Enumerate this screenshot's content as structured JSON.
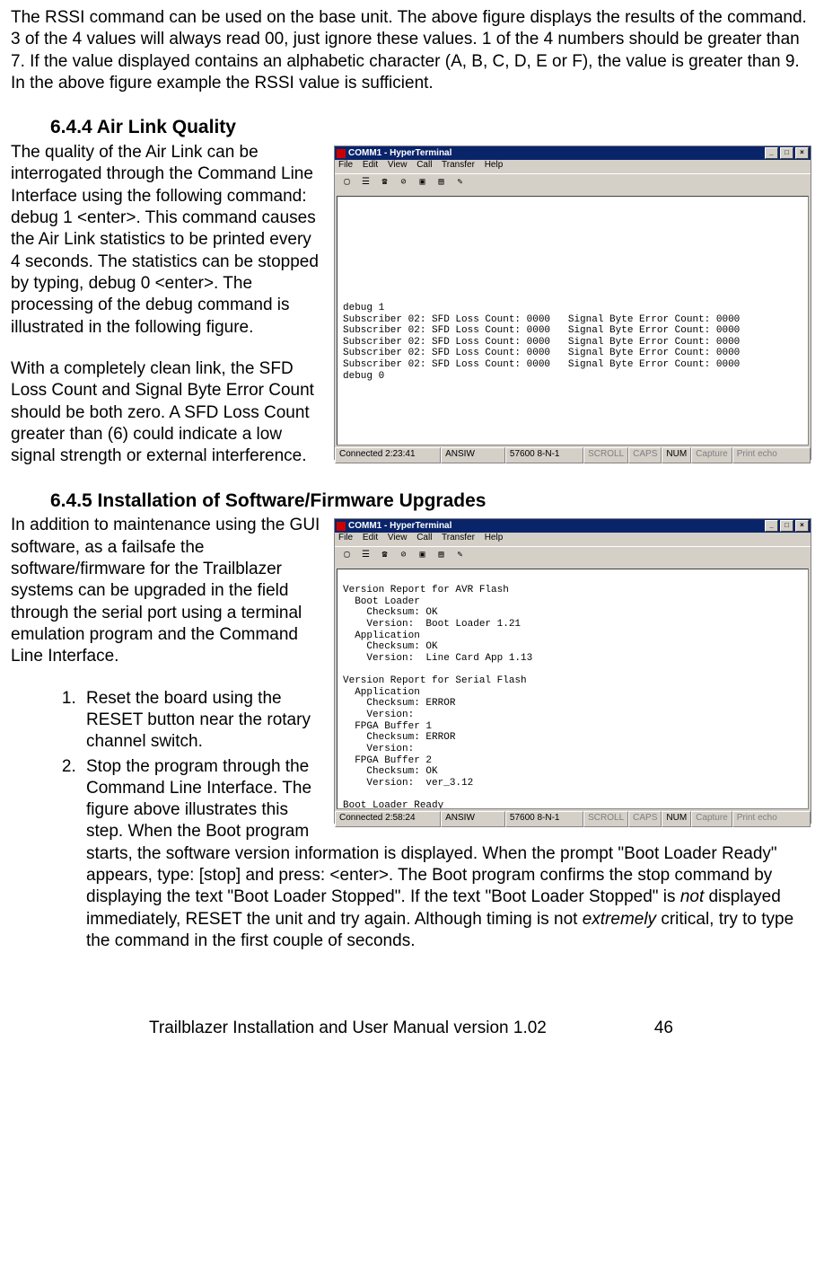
{
  "intro_paragraph": "The RSSI command can be used on the base unit.  The above figure displays the results of the command.  3 of the 4 values will always read 00, just ignore these values.  1 of the 4 numbers should be greater than 7.  If the value displayed contains an alphabetic character (A, B, C, D, E or F), the value is greater than 9.    In the above figure example the RSSI value is sufficient.",
  "section_644": {
    "heading": "6.4.4  Air Link Quality",
    "para1": "The quality of the Air Link can be interrogated through the Command Line Interface using the following command:  debug 1 <enter>.  This command causes the Air Link statistics to be printed every 4 seconds.  The statistics can be stopped by typing, debug 0 <enter>.   The processing of the debug command is illustrated in the following figure.",
    "para2": "With a completely clean link, the SFD Loss Count and Signal Byte Error Count should be both zero.  A SFD Loss Count greater than (6) could indicate a low signal strength or external interference."
  },
  "section_645": {
    "heading": "6.4.5  Installation of Software/Firmware Upgrades",
    "para1": "In addition to maintenance using the GUI software, as a failsafe the software/firmware for the Trailblazer systems can be upgraded in the field through the serial port using a terminal emulation program and the Command Line Interface.",
    "step1": "Reset the board using the RESET button near the rotary channel switch.",
    "step2_a": "Stop the program through the Command Line Interface.  The figure above illustrates this step.  When the Boot program starts, the software version information is displayed.  When the prompt \"Boot Loader Ready\" appears, type: [stop] and press: <enter>.  The Boot program confirms the stop command by displaying the text \"Boot Loader Stopped\". If the text \"Boot Loader Stopped\" is ",
    "step2_not": "not",
    "step2_b": " displayed immediately, RESET the unit and try again. Although timing is not ",
    "step2_ext": "extremely",
    "step2_c": " critical, try to type the command in the first couple of seconds."
  },
  "hyperterminal": {
    "title": "COMM1 - HyperTerminal",
    "menu": {
      "file": "File",
      "edit": "Edit",
      "view": "View",
      "call": "Call",
      "transfer": "Transfer",
      "help": "Help"
    },
    "status1": {
      "time": "Connected 2:23:41",
      "det": "ANSIW",
      "baud": "57600 8-N-1",
      "scroll": "SCROLL",
      "caps": "CAPS",
      "num": "NUM",
      "capture": "Capture",
      "print": "Print echo"
    },
    "status2": {
      "time": "Connected 2:58:24",
      "det": "ANSIW",
      "baud": "57600 8-N-1",
      "scroll": "SCROLL",
      "caps": "CAPS",
      "num": "NUM",
      "capture": "Capture",
      "print": "Print echo"
    }
  },
  "terminal1_text": "\n\n\n\n\n\n\n\n\ndebug 1\nSubscriber 02: SFD Loss Count: 0000   Signal Byte Error Count: 0000\nSubscriber 02: SFD Loss Count: 0000   Signal Byte Error Count: 0000\nSubscriber 02: SFD Loss Count: 0000   Signal Byte Error Count: 0000\nSubscriber 02: SFD Loss Count: 0000   Signal Byte Error Count: 0000\nSubscriber 02: SFD Loss Count: 0000   Signal Byte Error Count: 0000\ndebug 0\n\n\n\n\n\n_",
  "terminal2_text": "\nVersion Report for AVR Flash\n  Boot Loader\n    Checksum: OK\n    Version:  Boot Loader 1.21\n  Application\n    Checksum: OK\n    Version:  Line Card App 1.13\n\nVersion Report for Serial Flash\n  Application\n    Checksum: ERROR\n    Version:\n  FPGA Buffer 1\n    Checksum: ERROR\n    Version:\n  FPGA Buffer 2\n    Checksum: OK\n    Version:  ver_3.12\n\nBoot Loader Ready\nstop\n\nBoot Loader Stopped\n_",
  "footer": {
    "left": "Trailblazer Installation and User Manual version 1.02",
    "right": "46"
  }
}
